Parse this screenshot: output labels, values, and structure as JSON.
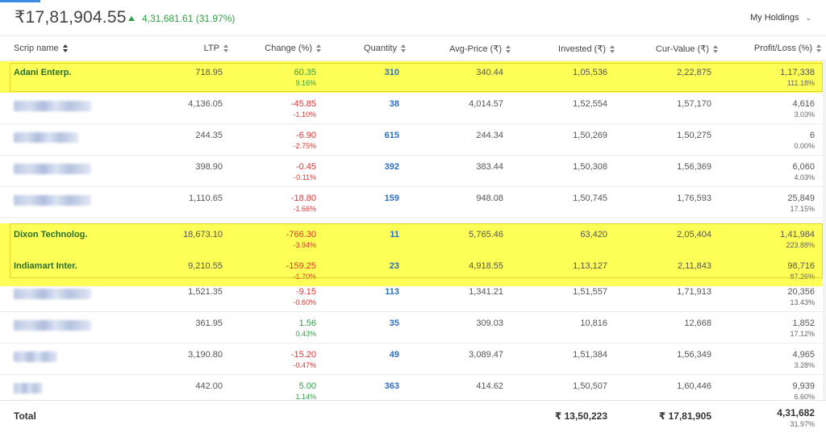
{
  "portfolio": {
    "value": "₹17,81,904.55",
    "day_pnl": "4,31,681.61 (31.97%)"
  },
  "holdings_selector": {
    "label": "My Holdings"
  },
  "columns": {
    "scrip": "Scrip name",
    "ltp": "LTP",
    "change": "Change (%)",
    "quantity": "Quantity",
    "avg_price": "Avg-Price (₹)",
    "invested": "Invested (₹)",
    "cur_value": "Cur-Value (₹)",
    "pnl": "Profit/Loss (%)"
  },
  "rows": [
    {
      "name": "Adani Enterp.",
      "ltp": "718.95",
      "change": "60.35",
      "change_pct": "9.16%",
      "qty": "310",
      "avg": "340.44",
      "invested": "1,05,536",
      "cur": "2,22,875",
      "pl": "1,17,338",
      "pl_pct": "111.18%"
    },
    {
      "name": "",
      "ltp": "4,136.05",
      "change": "-45.85",
      "change_pct": "-1.10%",
      "qty": "38",
      "avg": "4,014.57",
      "invested": "1,52,554",
      "cur": "1,57,170",
      "pl": "4,616",
      "pl_pct": "3.03%"
    },
    {
      "name": "",
      "ltp": "244.35",
      "change": "-6.90",
      "change_pct": "-2.75%",
      "qty": "615",
      "avg": "244.34",
      "invested": "1,50,269",
      "cur": "1,50,275",
      "pl": "6",
      "pl_pct": "0.00%"
    },
    {
      "name": "",
      "ltp": "398.90",
      "change": "-0.45",
      "change_pct": "-0.11%",
      "qty": "392",
      "avg": "383.44",
      "invested": "1,50,308",
      "cur": "1,56,369",
      "pl": "6,060",
      "pl_pct": "4.03%"
    },
    {
      "name": "",
      "ltp": "1,110.65",
      "change": "-18.80",
      "change_pct": "-1.66%",
      "qty": "159",
      "avg": "948.08",
      "invested": "1,50,745",
      "cur": "1,76,593",
      "pl": "25,849",
      "pl_pct": "17.15%"
    },
    {
      "name": "Dixon Technolog.",
      "ltp": "18,673.10",
      "change": "-766.30",
      "change_pct": "-3.94%",
      "qty": "11",
      "avg": "5,765.46",
      "invested": "63,420",
      "cur": "2,05,404",
      "pl": "1,41,984",
      "pl_pct": "223.88%"
    },
    {
      "name": "Indiamart Inter.",
      "ltp": "9,210.55",
      "change": "-159.25",
      "change_pct": "-1.70%",
      "qty": "23",
      "avg": "4,918.55",
      "invested": "1,13,127",
      "cur": "2,11,843",
      "pl": "98,716",
      "pl_pct": "87.26%"
    },
    {
      "name": "",
      "ltp": "1,521.35",
      "change": "-9.15",
      "change_pct": "-0.60%",
      "qty": "113",
      "avg": "1,341.21",
      "invested": "1,51,557",
      "cur": "1,71,913",
      "pl": "20,356",
      "pl_pct": "13.43%"
    },
    {
      "name": "",
      "ltp": "361.95",
      "change": "1.56",
      "change_pct": "0.43%",
      "qty": "35",
      "avg": "309.03",
      "invested": "10,816",
      "cur": "12,668",
      "pl": "1,852",
      "pl_pct": "17.12%"
    },
    {
      "name": "",
      "ltp": "3,190.80",
      "change": "-15.20",
      "change_pct": "-0.47%",
      "qty": "49",
      "avg": "3,089.47",
      "invested": "1,51,384",
      "cur": "1,56,349",
      "pl": "4,965",
      "pl_pct": "3.28%"
    },
    {
      "name": "",
      "ltp": "442.00",
      "change": "5.00",
      "change_pct": "1.14%",
      "qty": "363",
      "avg": "414.62",
      "invested": "1,50,507",
      "cur": "1,60,446",
      "pl": "9,939",
      "pl_pct": "6.60%"
    }
  ],
  "totals": {
    "label": "Total",
    "invested": "₹ 13,50,223",
    "cur_value": "₹ 17,81,905",
    "pl": "4,31,682",
    "pl_pct": "31.97%"
  },
  "colors": {
    "highlight": "#feff57",
    "positive": "#2f9e44",
    "negative": "#e03131",
    "quantity": "#2a6fc4",
    "accent": "#3d8be0"
  }
}
